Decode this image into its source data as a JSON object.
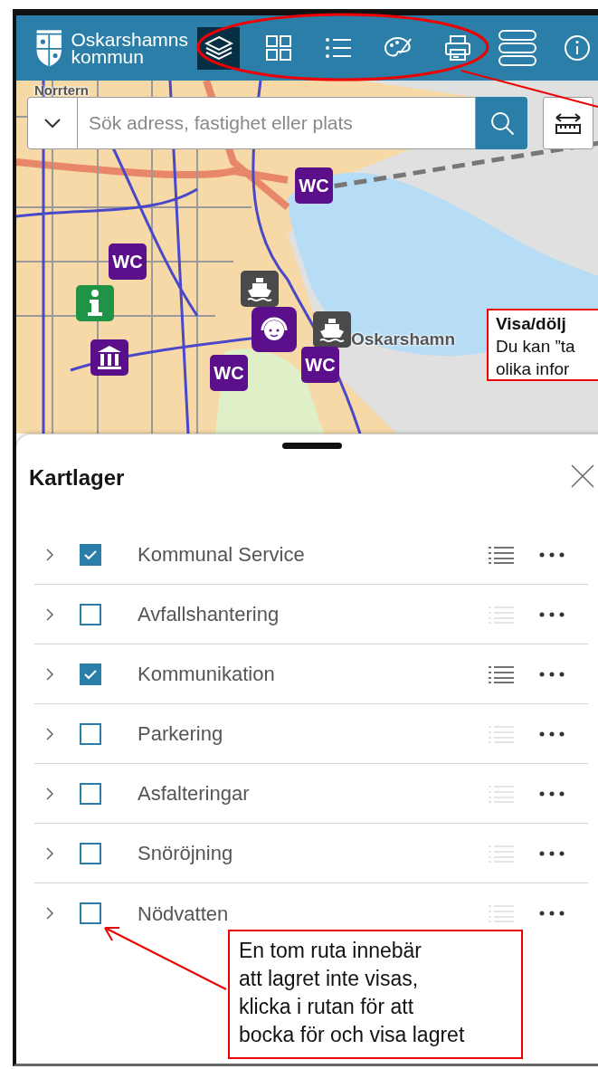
{
  "header": {
    "logo_lines": [
      "Oskarshamns",
      "kommun"
    ],
    "tools": [
      {
        "kind": "layers",
        "selected": true
      },
      {
        "kind": "grid",
        "selected": false
      },
      {
        "kind": "list",
        "selected": false
      },
      {
        "kind": "palette",
        "selected": false
      },
      {
        "kind": "print",
        "selected": false
      },
      {
        "kind": "basemap",
        "selected": false
      },
      {
        "kind": "info",
        "selected": false
      }
    ]
  },
  "search": {
    "placeholder": "Sök adress, fastighet eller plats"
  },
  "map": {
    "labels": [
      "Norrtern",
      "Oskarshamn"
    ],
    "markers": [
      {
        "kind": "wc",
        "label": "WC"
      },
      {
        "kind": "wc",
        "label": "WC"
      },
      {
        "kind": "info"
      },
      {
        "kind": "museum"
      },
      {
        "kind": "ferry"
      },
      {
        "kind": "support"
      },
      {
        "kind": "ferry"
      },
      {
        "kind": "wc",
        "label": "WC"
      },
      {
        "kind": "wc",
        "label": "WC"
      }
    ],
    "callout": {
      "title": "Visa/dölj",
      "lines": [
        "Du kan ”ta",
        "olika infor"
      ]
    }
  },
  "panel": {
    "title": "Kartlager",
    "layers": [
      {
        "name": "Kommunal Service",
        "checked": true
      },
      {
        "name": "Avfallshantering",
        "checked": false
      },
      {
        "name": "Kommunikation",
        "checked": true
      },
      {
        "name": "Parkering",
        "checked": false
      },
      {
        "name": "Asfalteringar",
        "checked": false
      },
      {
        "name": "Snöröjning",
        "checked": false
      },
      {
        "name": "Nödvatten",
        "checked": false
      }
    ]
  },
  "annotation": {
    "lines": [
      "En tom ruta innebär",
      "att lagret inte visas,",
      "klicka i rutan för att",
      "bocka för och visa lagret"
    ]
  }
}
